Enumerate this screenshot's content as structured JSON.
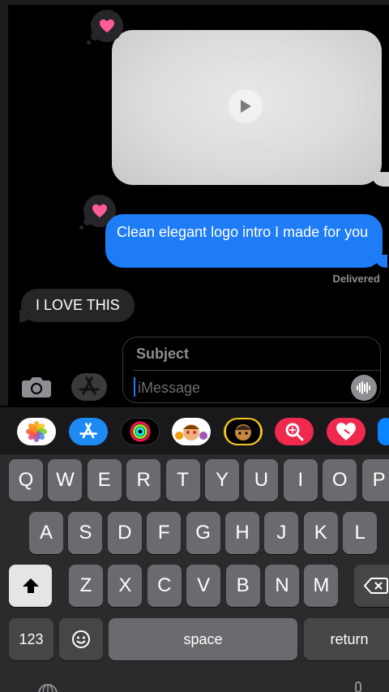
{
  "conversation": {
    "outgoing_text": "Clean elegant logo intro I made for you",
    "delivered_label": "Delivered",
    "incoming_text": "I LOVE THIS"
  },
  "reactions": {
    "video_reaction": "heart-icon",
    "text_reaction": "heart-icon"
  },
  "composer": {
    "subject_placeholder": "Subject",
    "message_placeholder": "iMessage"
  },
  "apps": [
    "photos-app-icon",
    "app-store-app-icon",
    "activity-app-icon",
    "memoji-app-icon",
    "animoji-app-icon",
    "image-search-app-icon",
    "digital-touch-app-icon"
  ],
  "keyboard": {
    "row1": [
      "Q",
      "W",
      "E",
      "R",
      "T",
      "Y",
      "U",
      "I",
      "O",
      "P"
    ],
    "row2": [
      "A",
      "S",
      "D",
      "F",
      "G",
      "H",
      "J",
      "K",
      "L"
    ],
    "row3": [
      "Z",
      "X",
      "C",
      "V",
      "B",
      "N",
      "M"
    ],
    "numbers_label": "123",
    "space_label": "space",
    "return_label": "return"
  },
  "colors": {
    "bubble_blue": "#1f7cf7",
    "heart_pink": "#ff5c93",
    "key_gray": "#6b6b6f"
  }
}
